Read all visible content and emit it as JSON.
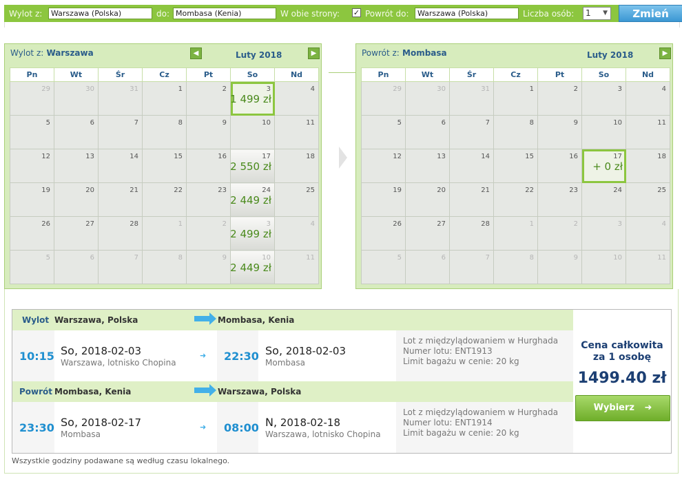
{
  "search": {
    "from_label": "Wylot z:",
    "from_value": "Warszawa (Polska)",
    "to_label": "do:",
    "to_value": "Mombasa (Kenia)",
    "roundtrip_label": "W obie strony:",
    "roundtrip_checked": "✓",
    "return_label": "Powrót do:",
    "return_value": "Warszawa (Polska)",
    "pax_label": "Liczba osób:",
    "pax_value": "1",
    "submit_label": "Zmień"
  },
  "outbound_calendar": {
    "title_prefix": "Wylot z:",
    "title_city": "Warszawa",
    "month": "Luty 2018",
    "weekdays": [
      "Pn",
      "Wt",
      "Śr",
      "Cz",
      "Pt",
      "So",
      "Nd"
    ],
    "weeks": [
      [
        {
          "d": "29",
          "m": true
        },
        {
          "d": "30",
          "m": true
        },
        {
          "d": "31",
          "m": true
        },
        {
          "d": "1"
        },
        {
          "d": "2"
        },
        {
          "d": "3",
          "price": "1 499 zł",
          "sel": true
        },
        {
          "d": "4"
        }
      ],
      [
        {
          "d": "5"
        },
        {
          "d": "6"
        },
        {
          "d": "7"
        },
        {
          "d": "8"
        },
        {
          "d": "9"
        },
        {
          "d": "10"
        },
        {
          "d": "11"
        }
      ],
      [
        {
          "d": "12"
        },
        {
          "d": "13"
        },
        {
          "d": "14"
        },
        {
          "d": "15"
        },
        {
          "d": "16"
        },
        {
          "d": "17",
          "price": "2 550 zł"
        },
        {
          "d": "18"
        }
      ],
      [
        {
          "d": "19"
        },
        {
          "d": "20"
        },
        {
          "d": "21"
        },
        {
          "d": "22"
        },
        {
          "d": "23"
        },
        {
          "d": "24",
          "price": "2 449 zł"
        },
        {
          "d": "25"
        }
      ],
      [
        {
          "d": "26"
        },
        {
          "d": "27"
        },
        {
          "d": "28"
        },
        {
          "d": "1",
          "m": true
        },
        {
          "d": "2",
          "m": true
        },
        {
          "d": "3",
          "m": true,
          "price": "2 499 zł"
        },
        {
          "d": "4",
          "m": true
        }
      ],
      [
        {
          "d": "5",
          "m": true
        },
        {
          "d": "6",
          "m": true
        },
        {
          "d": "7",
          "m": true
        },
        {
          "d": "8",
          "m": true
        },
        {
          "d": "9",
          "m": true
        },
        {
          "d": "10",
          "m": true,
          "price": "2 449 zł"
        },
        {
          "d": "11",
          "m": true
        }
      ]
    ]
  },
  "return_calendar": {
    "title_prefix": "Powrót z:",
    "title_city": "Mombasa",
    "month": "Luty 2018",
    "weekdays": [
      "Pn",
      "Wt",
      "Śr",
      "Cz",
      "Pt",
      "So",
      "Nd"
    ],
    "weeks": [
      [
        {
          "d": "29",
          "m": true
        },
        {
          "d": "30",
          "m": true
        },
        {
          "d": "31",
          "m": true
        },
        {
          "d": "1"
        },
        {
          "d": "2"
        },
        {
          "d": "3"
        },
        {
          "d": "4"
        }
      ],
      [
        {
          "d": "5"
        },
        {
          "d": "6"
        },
        {
          "d": "7"
        },
        {
          "d": "8"
        },
        {
          "d": "9"
        },
        {
          "d": "10"
        },
        {
          "d": "11"
        }
      ],
      [
        {
          "d": "12"
        },
        {
          "d": "13"
        },
        {
          "d": "14"
        },
        {
          "d": "15"
        },
        {
          "d": "16"
        },
        {
          "d": "17",
          "price": "+ 0 zł",
          "sel": true
        },
        {
          "d": "18"
        }
      ],
      [
        {
          "d": "19"
        },
        {
          "d": "20"
        },
        {
          "d": "21"
        },
        {
          "d": "22"
        },
        {
          "d": "23"
        },
        {
          "d": "24"
        },
        {
          "d": "25"
        }
      ],
      [
        {
          "d": "26"
        },
        {
          "d": "27"
        },
        {
          "d": "28"
        },
        {
          "d": "1",
          "m": true
        },
        {
          "d": "2",
          "m": true
        },
        {
          "d": "3",
          "m": true
        },
        {
          "d": "4",
          "m": true
        }
      ],
      [
        {
          "d": "5",
          "m": true
        },
        {
          "d": "6",
          "m": true
        },
        {
          "d": "7",
          "m": true
        },
        {
          "d": "8",
          "m": true
        },
        {
          "d": "9",
          "m": true
        },
        {
          "d": "10",
          "m": true
        },
        {
          "d": "11",
          "m": true
        }
      ]
    ]
  },
  "outbound": {
    "label": "Wylot",
    "from": "Warszawa, Polska",
    "to": "Mombasa, Kenia",
    "dep_time": "10:15",
    "dep_day": "So,",
    "dep_date": "2018-02-03",
    "dep_place": "Warszawa, lotnisko Chopina",
    "arr_time": "22:30",
    "arr_day": "So,",
    "arr_date": "2018-02-03",
    "arr_place": "Mombasa",
    "info1": "Lot z międzylądowaniem w Hurghada",
    "info2": "Numer lotu: ENT1913",
    "info3": "Limit bagażu w cenie: 20 kg"
  },
  "return": {
    "label": "Powrót",
    "from": "Mombasa, Kenia",
    "to": "Warszawa, Polska",
    "dep_time": "23:30",
    "dep_day": "So,",
    "dep_date": "2018-02-17",
    "dep_place": "Mombasa",
    "arr_time": "08:00",
    "arr_day": "N,",
    "arr_date": "2018-02-18",
    "arr_place": "Warszawa, lotnisko Chopina",
    "info1": "Lot z międzylądowaniem w Hurghada",
    "info2": "Numer lotu: ENT1914",
    "info3": "Limit bagażu w cenie: 20 kg"
  },
  "price": {
    "label_line1": "Cena całkowita",
    "label_line2": "za 1 osobę",
    "value": "1499.40 zł",
    "choose_label": "Wybierz"
  },
  "footnote": "Wszystkie godziny podawane są według czasu lokalnego.",
  "colors": {
    "accent_green": "#8cc63f",
    "price_green": "#4a8a1c",
    "link_blue": "#1f8fd0",
    "title_blue": "#2a5c8a"
  }
}
